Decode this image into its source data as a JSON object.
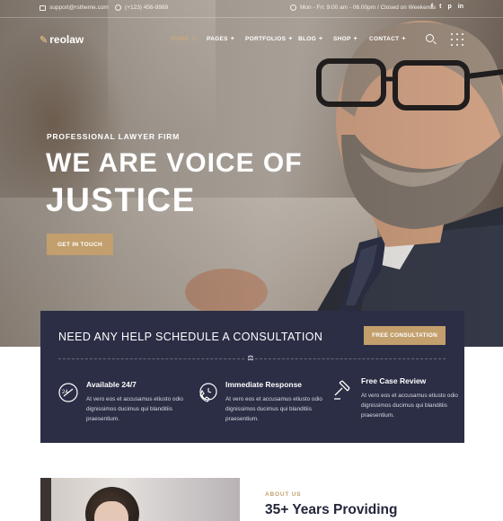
{
  "topbar": {
    "email": "support@rstheme.com",
    "phone": "(+123) 456-9989",
    "hours": "Mon - Fri: 9:00 am - 06.00pm / Closed on Weekends",
    "social": [
      "f",
      "t",
      "p",
      "in"
    ]
  },
  "brand": {
    "logo_mark": "✎",
    "name": "reolaw"
  },
  "nav": {
    "items": [
      {
        "label": "HOME",
        "suffix": "+"
      },
      {
        "label": "PAGES",
        "suffix": "+"
      },
      {
        "label": "PORTFOLIOS",
        "suffix": "+"
      },
      {
        "label": "BLOG",
        "suffix": "+"
      },
      {
        "label": "SHOP",
        "suffix": "+"
      },
      {
        "label": "CONTACT",
        "suffix": "+"
      }
    ]
  },
  "hero": {
    "eyebrow": "PROFESSIONAL LAWYER FIRM",
    "title_line1": "WE ARE VOICE OF",
    "title_line2": "JUSTICE",
    "cta": "GET IN TOUCH"
  },
  "consult": {
    "title": "NEED ANY HELP SCHEDULE A CONSULTATION",
    "button": "FREE CONSULTATION",
    "divider_icon": "⚖",
    "features": [
      {
        "title": "Available 24/7",
        "text": "At vero eos et accusamus etiusto odio dignissimos ducimus qui blanditiis praesentium.",
        "icon": "clock-24-icon"
      },
      {
        "title": "Immediate Response",
        "text": "At vero eos et accusamus etiusto odio dignissimos ducimus qui blanditiis praesentium.",
        "icon": "phone-response-icon"
      },
      {
        "title": "Free Case Review",
        "text": "At vero eos et accusamus etiusto odio dignissimos ducimus qui blanditiis praesentium.",
        "icon": "gavel-review-icon"
      }
    ]
  },
  "about": {
    "eyebrow": "ABOUT US",
    "title": "35+ Years Providing"
  },
  "colors": {
    "gold": "#c29f6c",
    "navy": "#2b2e45",
    "white": "#ffffff"
  }
}
